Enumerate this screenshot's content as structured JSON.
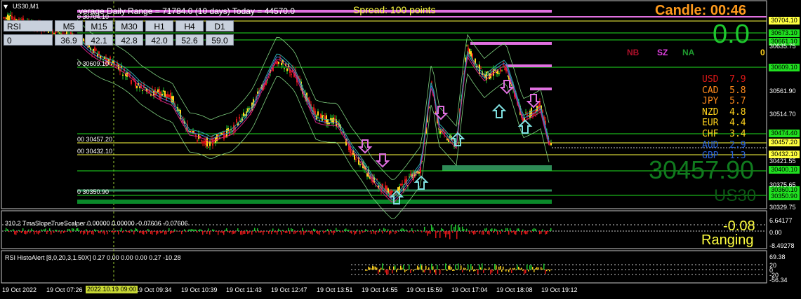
{
  "window": {
    "symbol_label": "US30,M1"
  },
  "header": {
    "daily_range": "verage Daily Range = 71784.0 (10 days)   Today = 44570.0",
    "spread": "Spread: 100 points",
    "candle_label": "Candle:  00:46"
  },
  "rsi_panel": {
    "label": "RSI",
    "timeframes": [
      "M5",
      "M15",
      "M30",
      "H1",
      "H4",
      "D1"
    ],
    "row_label": "0",
    "values": [
      "36.9",
      "42.1",
      "42.8",
      "42.0",
      "52.6",
      "59.0"
    ]
  },
  "big_value": "0.0",
  "indicator_flags": [
    {
      "label": "NB",
      "color": "#b0102a"
    },
    {
      "label": "SZ",
      "color": "#e040e0"
    },
    {
      "label": "NA",
      "color": "#1e9a2e"
    }
  ],
  "right_zero": "0",
  "currency_strength": [
    {
      "code": "USD",
      "value": "7.9",
      "color": "#e01818"
    },
    {
      "code": "CAD",
      "value": "5.8",
      "color": "#ff8a1c"
    },
    {
      "code": "JPY",
      "value": "5.7",
      "color": "#ff8a1c"
    },
    {
      "code": "NZD",
      "value": "4.8",
      "color": "#ffd21c"
    },
    {
      "code": "EUR",
      "value": "4.4",
      "color": "#ffd21c"
    },
    {
      "code": "CHF",
      "value": "3.4",
      "color": "#ffd21c"
    },
    {
      "code": "AUD",
      "value": "2.9",
      "color": "#2a62d8"
    },
    {
      "code": "GBP",
      "value": "1.3",
      "color": "#2a62d8"
    }
  ],
  "big_price": "30457.90",
  "big_symbol": "US30",
  "level_labels": [
    {
      "text": "0   30704.10"
    },
    {
      "text": "0   30609.10"
    },
    {
      "text": "00   30457.20"
    },
    {
      "text": "00   30432.10"
    },
    {
      "text": "0   30350.90"
    }
  ],
  "price_axis": {
    "boxed": [
      {
        "text": "30704.10",
        "bg": "#ffff40"
      },
      {
        "text": "30673.10",
        "bg": "#20e020"
      },
      {
        "text": "30661.10",
        "bg": "#20e020"
      },
      {
        "text": "30609.10",
        "bg": "#20e020"
      },
      {
        "text": "30474.40",
        "bg": "#20e020"
      },
      {
        "text": "30457.20",
        "bg": "#ffff40"
      },
      {
        "text": "30432.10",
        "bg": "#ffff40"
      },
      {
        "text": "30400.10",
        "bg": "#20e020"
      },
      {
        "text": "30360.10",
        "bg": "#20e020"
      },
      {
        "text": "30350.90",
        "bg": "#20e020"
      }
    ],
    "plain": [
      "30635.75",
      "30561.90",
      "30514.70",
      "30421.55",
      "30375.65",
      "30329.75"
    ]
  },
  "sub1": {
    "label": "310.2 TmaSlopeTrueScalper 0.00000 0.00000 -0.07606 -0.07606",
    "axis": [
      "6.64177",
      "0.00",
      "-8.49278"
    ],
    "value": "-0.08",
    "state": "Ranging"
  },
  "sub2": {
    "label": "RSI HistoAlert [8,0,20,3,1.50X] 0.27 0.00 0.00 0.00 0.27 -10.28",
    "axis": [
      "69.38",
      "20",
      "0",
      "-20",
      "-56.34"
    ]
  },
  "time_axis": [
    "19 Oct 2022",
    "19 Oct 07:26",
    "19 Oct 09:34",
    "19 Oct 10:39",
    "19 Oct 11:43",
    "19 Oct 12:47",
    "19 Oct 13:51",
    "19 Oct 14:55",
    "19 Oct 15:59",
    "19 Oct 17:04",
    "19 Oct 18:08",
    "19 Oct 19:12"
  ],
  "time_highlight": "2022.10.19 09:00"
}
